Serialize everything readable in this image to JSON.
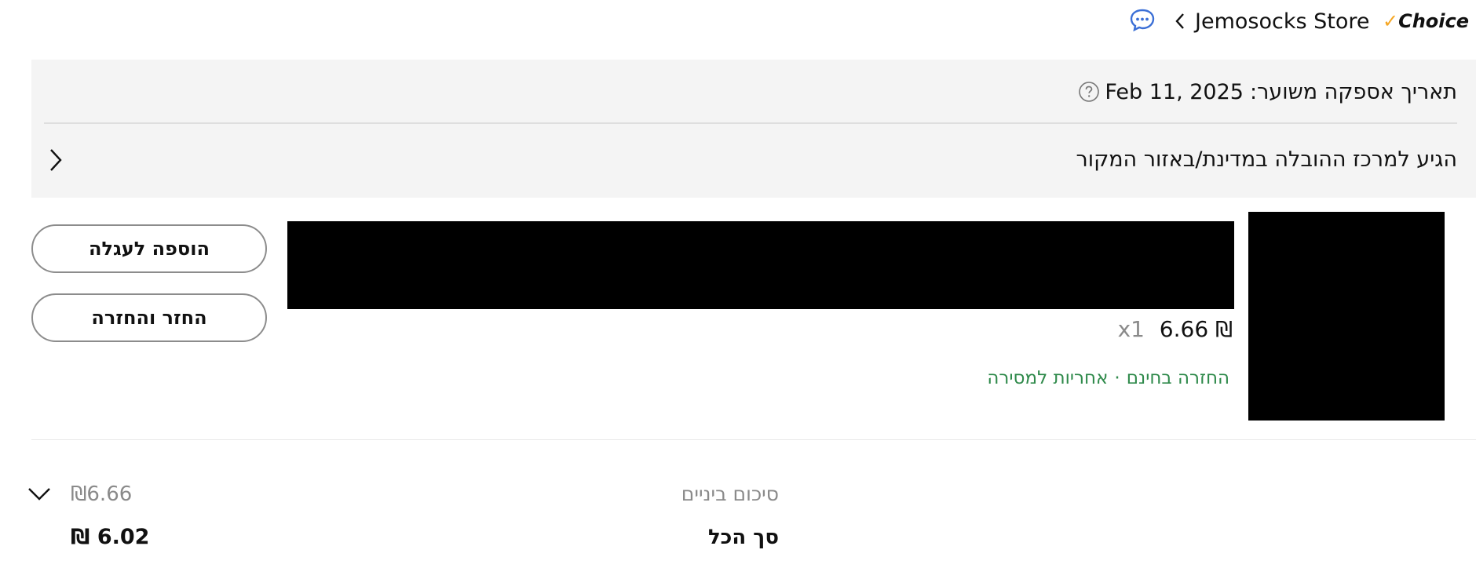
{
  "store": {
    "name": "Jemosocks Store",
    "choice_check": "✓",
    "choice_label": "Choice"
  },
  "delivery": {
    "estimated_label": "תאריך אספקה משוער:",
    "estimated_date": "Feb 11, 2025",
    "status": "הגיע למרכז ההובלה במדינת/באזור המקור"
  },
  "item": {
    "price": "6.66 ₪",
    "quantity": "x1",
    "benefit_free_return": "החזרה בחינם",
    "benefit_separator": "·",
    "benefit_delivery_guarantee": "אחריות למסירה"
  },
  "actions": {
    "add_to_cart": "הוספה לעגלה",
    "return_refund": "החזר והחזרה"
  },
  "summary": {
    "subtotal_label": "סיכום ביניים",
    "subtotal_value": "₪6.66",
    "total_label": "סך הכל",
    "total_value": "₪ 6.02"
  },
  "icons": {
    "chat": "chat-bubble-icon",
    "back": "chevron-left-icon",
    "help": "question-circle-icon",
    "expand": "chevron-right-icon",
    "collapse": "chevron-down-icon"
  },
  "colors": {
    "panel_bg": "#f4f4f4",
    "benefit_green": "#2f8a4b",
    "chat_blue": "#3b6fd6",
    "choice_orange": "#f5a623"
  }
}
